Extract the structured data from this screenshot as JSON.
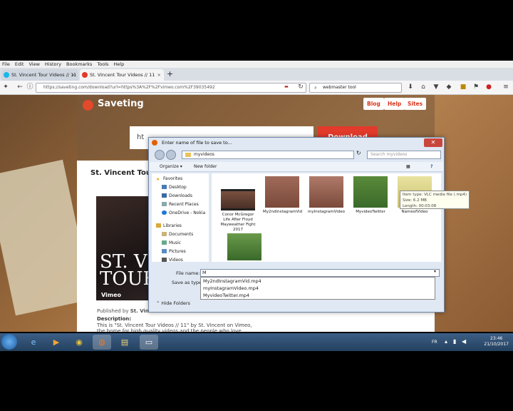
{
  "browser": {
    "menu": [
      "File",
      "Edit",
      "View",
      "History",
      "Bookmarks",
      "Tools",
      "Help"
    ],
    "tabs": [
      {
        "label": "St. Vincent Tour Videos // 11"
      },
      {
        "label": "St. Vincent Tour Videos // 11"
      }
    ],
    "url": "https://saveting.com/download?url=https%3A%2F%2Fvimeo.com%2F39035492",
    "search_value": "webmaster tool"
  },
  "page": {
    "logo": "Saveting",
    "buttons": {
      "blog": "Blog",
      "help": "Help",
      "sites": "Sites"
    },
    "url_input_value": "ht",
    "download_button": "Download",
    "video_title": "St. Vincent Tour",
    "thumb_text": "ST. VI\nTOUR V",
    "thumb_brand": "Vimeo",
    "published_prefix": "Published by",
    "published_author": "St. Vince",
    "description_label": "Description:",
    "description_text": "This is \"St. Vincent Tour Videos // 11\" by St. Vincent on Vimeo, the home for high quality videos and the people who love"
  },
  "dialog": {
    "title": "Enter name of file to save to...",
    "address": "myvideos",
    "search_placeholder": "Search myvideos",
    "toolbar": {
      "organize": "Organize ▾",
      "new_folder": "New folder"
    },
    "sidebar": {
      "favorites": "Favorites",
      "items": [
        "Desktop",
        "Downloads",
        "Recent Places",
        "OneDrive - Nokia"
      ],
      "libraries": "Libraries",
      "lib_items": [
        "Documents",
        "Music",
        "Pictures",
        "Videos"
      ]
    },
    "files": [
      {
        "name": "Conor McGregor Life After Floyd Mayweather Fight 2017"
      },
      {
        "name": "My2ndInstagramVid"
      },
      {
        "name": "myInstagramVideo"
      },
      {
        "name": "MyvideoTwitter"
      },
      {
        "name": "NameofVideo"
      }
    ],
    "tooltip": {
      "type": "Item type: VLC media file (.mp4)",
      "size": "Size: 6.2 MB",
      "length": "Length: 00:03:08"
    },
    "file_name_label": "File name:",
    "file_name_value": "M",
    "save_as_label": "Save as type:",
    "autocomplete": [
      "My2ndInstagramVid.mp4",
      "myInstagramVideo.mp4",
      "MyvideoTwitter.mp4"
    ],
    "hide_folders": "Hide Folders"
  },
  "taskbar": {
    "lang": "FR",
    "time": "23:46",
    "date": "21/10/2017"
  }
}
